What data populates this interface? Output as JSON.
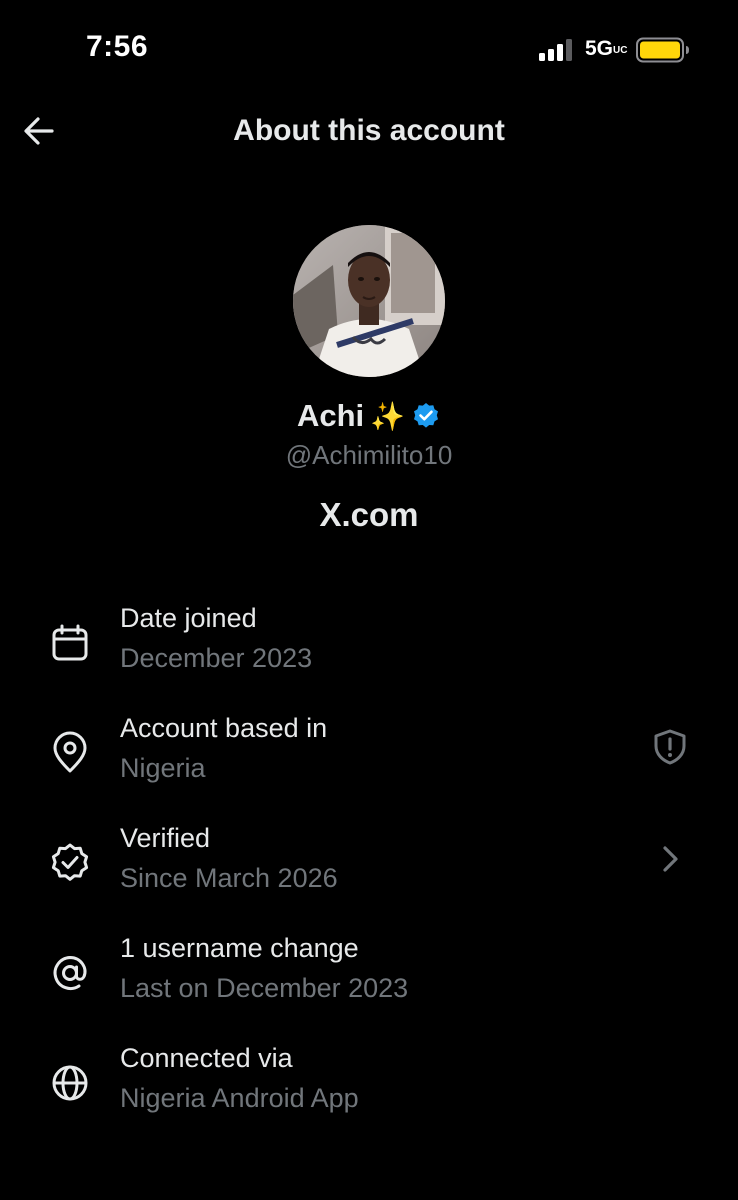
{
  "status_bar": {
    "time": "7:56",
    "network": "5G",
    "network_suffix": "UC",
    "battery_color": "#FFD60A",
    "icons": [
      "signal-icon",
      "battery-icon"
    ]
  },
  "header": {
    "title": "About this account",
    "back_icon": "arrow-left-icon"
  },
  "profile": {
    "display_name": "Achi",
    "name_emoji": "✨",
    "verified_badge": "verified-badge-icon",
    "verified_color": "#1D9BF0",
    "handle": "@Achimilito10",
    "platform": "X.com"
  },
  "info": [
    {
      "icon": "calendar-icon",
      "label": "Date joined",
      "value": "December 2023",
      "trailing": null
    },
    {
      "icon": "location-pin-icon",
      "label": "Account based in",
      "value": "Nigeria",
      "trailing": "shield-alert-icon"
    },
    {
      "icon": "verified-check-icon",
      "label": "Verified",
      "value": "Since March 2026",
      "trailing": "chevron-right-icon"
    },
    {
      "icon": "at-sign-icon",
      "label": "1 username change",
      "value": "Last on December 2023",
      "trailing": null
    },
    {
      "icon": "globe-icon",
      "label": "Connected via",
      "value": "Nigeria Android App",
      "trailing": null
    }
  ],
  "colors": {
    "background": "#000000",
    "primary_text": "#E7E9EA",
    "secondary_text": "#71767B"
  }
}
